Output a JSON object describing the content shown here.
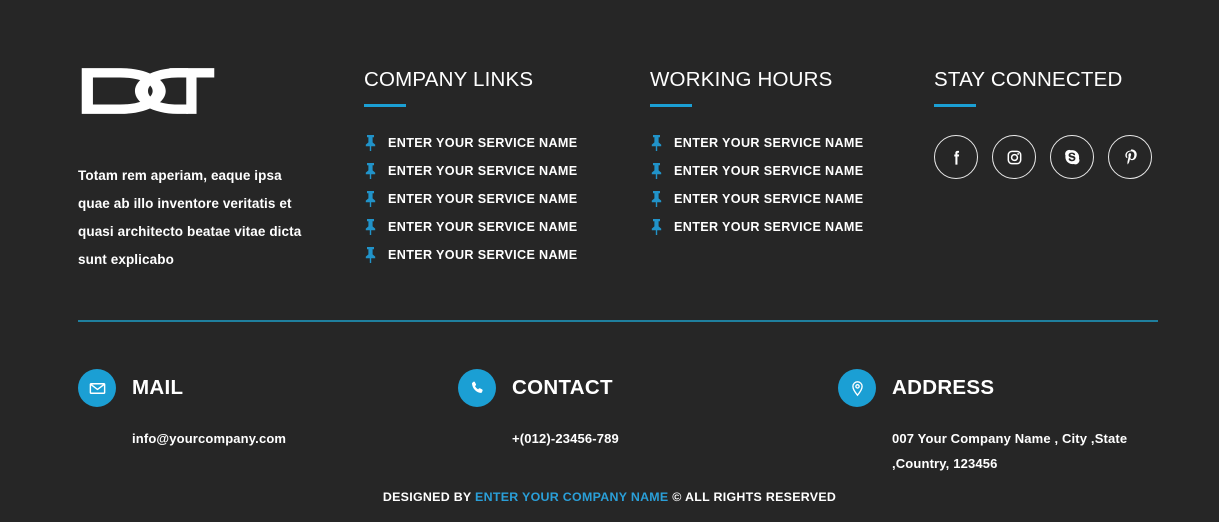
{
  "theme": {
    "background": "#262626",
    "accent": "#1b9fd4",
    "accent_link": "#2a9fd8",
    "divider": "#1f7f9e",
    "text": "#ffffff"
  },
  "brand": {
    "logo_text": "DCT",
    "logo_name": "dct-logo",
    "description": "Totam rem aperiam, eaque ipsa quae ab illo inventore veritatis et quasi architecto beatae vitae dicta sunt explicabo"
  },
  "columns": [
    {
      "id": "company-links",
      "title": "COMPANY LINKS",
      "items": [
        {
          "icon": "pin-icon",
          "label": "ENTER YOUR SERVICE NAME"
        },
        {
          "icon": "pin-icon",
          "label": "ENTER YOUR SERVICE NAME"
        },
        {
          "icon": "pin-icon",
          "label": "ENTER YOUR SERVICE NAME"
        },
        {
          "icon": "pin-icon",
          "label": "ENTER YOUR SERVICE NAME"
        },
        {
          "icon": "pin-icon",
          "label": "ENTER YOUR SERVICE NAME"
        }
      ]
    },
    {
      "id": "working-hours",
      "title": "WORKING HOURS",
      "items": [
        {
          "icon": "pin-icon",
          "label": "ENTER YOUR SERVICE NAME"
        },
        {
          "icon": "pin-icon",
          "label": "ENTER YOUR SERVICE NAME"
        },
        {
          "icon": "pin-icon",
          "label": "ENTER YOUR SERVICE NAME"
        },
        {
          "icon": "pin-icon",
          "label": "ENTER YOUR SERVICE NAME"
        }
      ]
    }
  ],
  "social": {
    "title": "STAY CONNECTED",
    "items": [
      {
        "id": "facebook",
        "icon": "facebook-icon",
        "label": "Facebook"
      },
      {
        "id": "instagram",
        "icon": "instagram-icon",
        "label": "Instagram"
      },
      {
        "id": "skype",
        "icon": "skype-icon",
        "label": "Skype"
      },
      {
        "id": "pinterest",
        "icon": "pinterest-icon",
        "label": "Pinterest"
      }
    ]
  },
  "contacts": [
    {
      "id": "mail",
      "icon": "envelope-icon",
      "title": "MAIL",
      "value": "info@yourcompany.com"
    },
    {
      "id": "contact",
      "icon": "phone-icon",
      "title": "CONTACT",
      "value": "+(012)-23456-789"
    },
    {
      "id": "address",
      "icon": "location-pin-icon",
      "title": "ADDRESS",
      "value": "007 Your Company Name , City ,State ,Country, 123456"
    }
  ],
  "bottom": {
    "prefix": "DESIGNED BY",
    "company": "ENTER YOUR COMPANY NAME",
    "suffix": "© ALL RIGHTS RESERVED"
  }
}
